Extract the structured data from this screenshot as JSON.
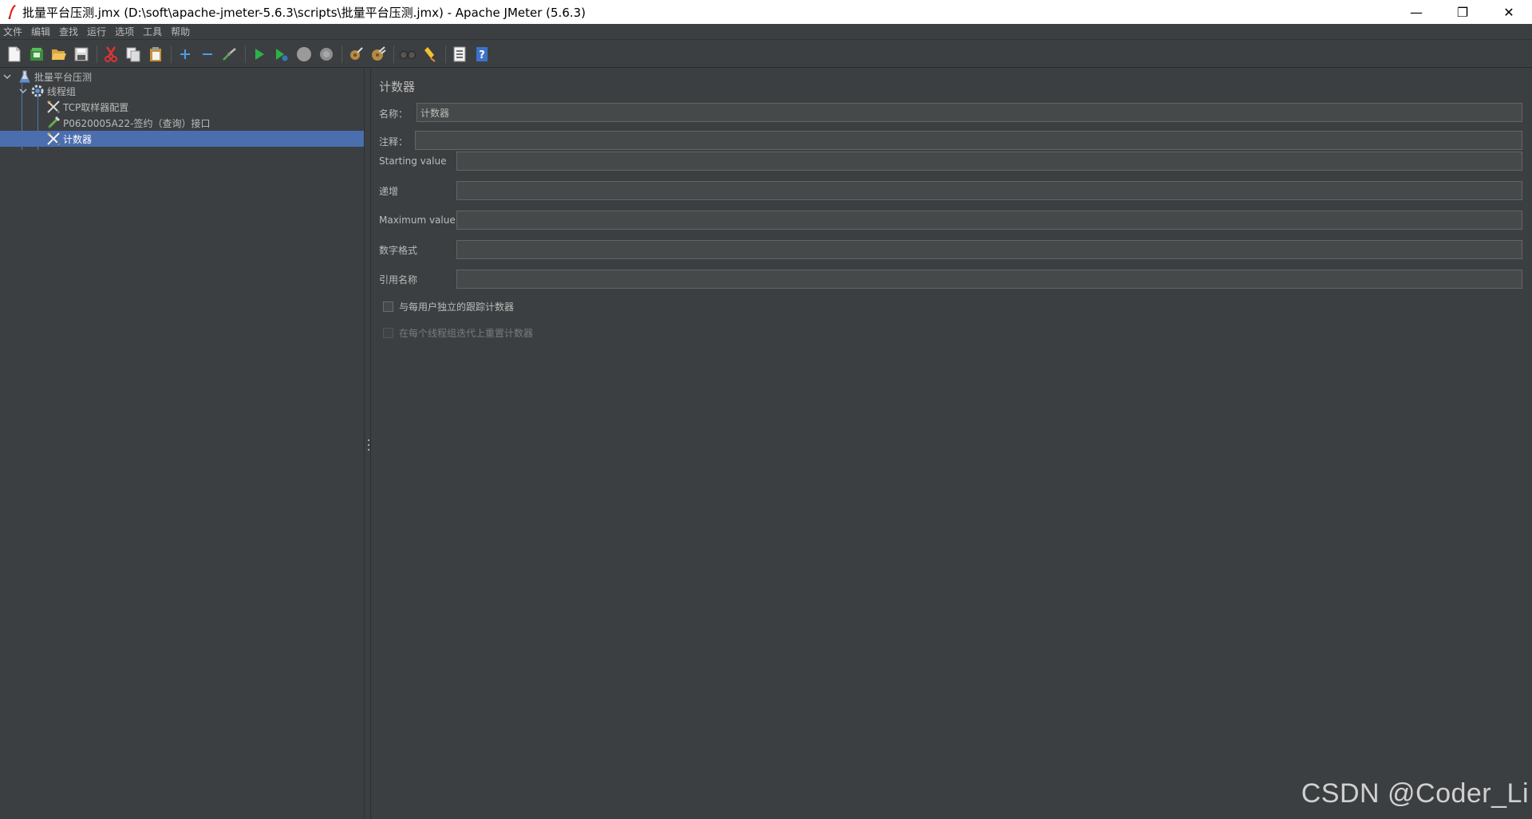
{
  "window": {
    "title": "批量平台压测.jmx (D:\\soft\\apache-jmeter-5.6.3\\scripts\\批量平台压测.jmx) - Apache JMeter (5.6.3)",
    "minimize": "—",
    "restore": "❐",
    "close": "✕"
  },
  "menu": [
    "文件",
    "编辑",
    "查找",
    "运行",
    "选项",
    "工具",
    "帮助"
  ],
  "toolbar": {
    "icons": [
      "new-icon",
      "templates-icon",
      "open-icon",
      "save-icon",
      "cut-icon",
      "copy-icon",
      "paste-icon",
      "expand-icon",
      "collapse-icon",
      "toggle-icon",
      "start-icon",
      "start-no-timers-icon",
      "stop-icon",
      "shutdown-icon",
      "clear-icon",
      "clear-all-icon",
      "search-icon",
      "reset-search-icon",
      "function-helper-icon",
      "help-icon"
    ]
  },
  "tree": {
    "items": [
      {
        "label": "批量平台压测",
        "icon": "test-plan-icon",
        "level": 0,
        "expanded": true
      },
      {
        "label": "线程组",
        "icon": "thread-group-icon",
        "level": 1,
        "expanded": true
      },
      {
        "label": "TCP取样器配置",
        "icon": "config-element-icon",
        "level": 2
      },
      {
        "label": "P0620005A22-签约（查询）接口",
        "icon": "sampler-icon",
        "level": 2
      },
      {
        "label": "计数器",
        "icon": "config-element-icon",
        "level": 2,
        "selected": true
      }
    ]
  },
  "form": {
    "title": "计数器",
    "name_label": "名称：",
    "name_value": "计数器",
    "comment_label": "注释：",
    "comment_value": "",
    "starting_label": "Starting value",
    "starting_value": "",
    "increment_label": "递增",
    "increment_value": "",
    "maximum_label": "Maximum value",
    "maximum_value": "",
    "format_label": "数字格式",
    "format_value": "",
    "refname_label": "引用名称",
    "refname_value": "",
    "per_user_label": "与每用户独立的跟踪计数器",
    "reset_label": "在每个线程组迭代上重置计数器"
  },
  "watermark": "CSDN @Coder_Li",
  "colors": {
    "background": "#3c3f41",
    "selection": "#4b6eaf",
    "input": "#45494a"
  }
}
